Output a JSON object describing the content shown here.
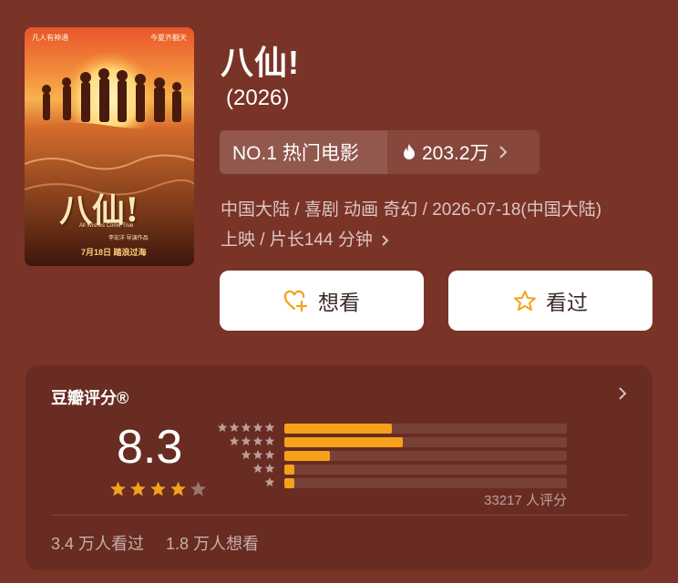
{
  "movie": {
    "title": "八仙!",
    "year": "(2026)",
    "poster": {
      "tagline_left": "凡人有神通",
      "tagline_right": "今夏齐翻天",
      "logo_text": "八仙!",
      "english_title": "All Wishes Come True",
      "release_line": "7月18日 踏浪过海",
      "director": "李宏洋 导演作品"
    },
    "rank_label": "NO.1 热门电影",
    "heat": "203.2万",
    "meta_line1": "中国大陆 / 喜剧 动画 奇幻 / 2026-07-18(中国大陆)",
    "meta_line2": "上映 / 片长144 分钟"
  },
  "actions": {
    "want_label": "想看",
    "seen_label": "看过"
  },
  "rating": {
    "section_title": "豆瓣评分®",
    "score": "8.3",
    "stars_filled": 4,
    "stars_total": 5,
    "distribution": [
      {
        "stars": 5,
        "fraction": 0.38
      },
      {
        "stars": 4,
        "fraction": 0.42
      },
      {
        "stars": 3,
        "fraction": 0.16
      },
      {
        "stars": 2,
        "fraction": 0.035
      },
      {
        "stars": 1,
        "fraction": 0.035
      }
    ],
    "count_label": "33217 人评分",
    "seen_count": "3.4 万人看过",
    "want_count": "1.8 万人想看"
  },
  "colors": {
    "background": "#7a3327",
    "card": "#692c22",
    "bar_fill": "#f5a11a",
    "star_filled": "#f5a11a"
  }
}
